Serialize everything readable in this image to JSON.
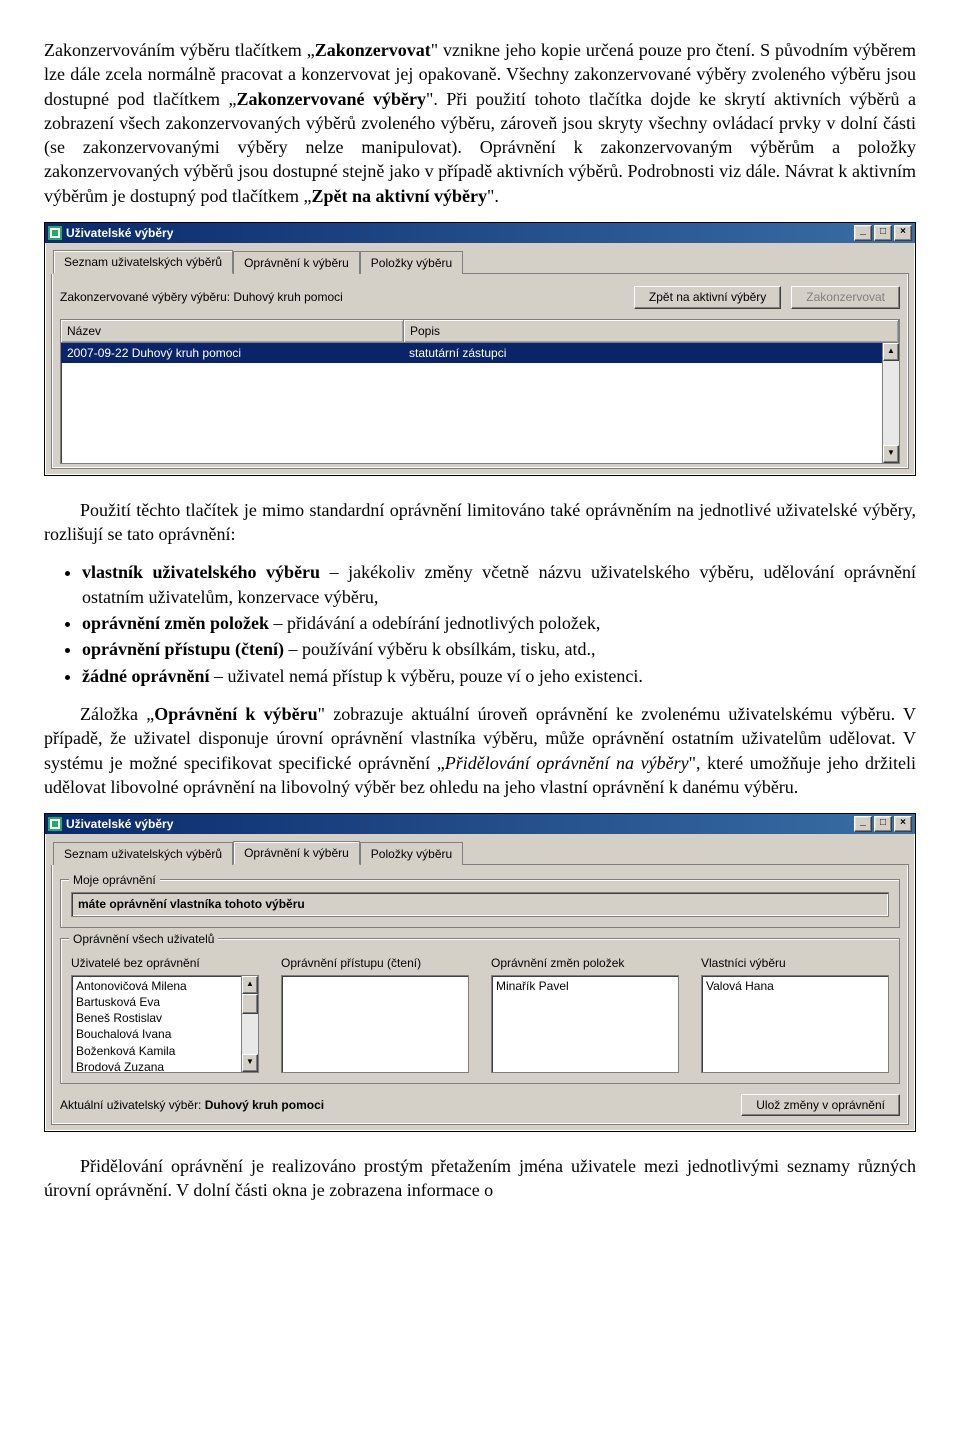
{
  "para1": {
    "seg1": "Zakonzervováním výběru tlačítkem „",
    "btn_zakonzervovat": "Zakonzervovat",
    "seg2": "\" vznikne jeho kopie určená pouze pro čtení. S původním výběrem lze dále zcela normálně pracovat a konzervovat jej opakovaně. Všechny zakonzervované výběry zvoleného výběru jsou dostupné pod tlačítkem „",
    "btn_zakonzervovane": "Zakonzervované výběry",
    "seg3": "\". Při použití tohoto tlačítka dojde ke skrytí aktivních výběrů a zobrazení všech zakonzervovaných výběrů zvoleného výběru, zároveň jsou skryty všechny ovládací prvky v dolní části (se zakonzervovanými výběry nelze manipulovat). Oprávnění k zakonzervovaným výběrům a položky zakonzervovaných výběrů jsou dostupné stejně jako v případě aktivních výběrů. Podrobnosti viz dále. Návrat k aktivním výběrům je dostupný pod tlačítkem „",
    "btn_zpet": "Zpět na aktivní výběry",
    "seg4": "\"."
  },
  "win1": {
    "title": "Uživatelské výběry",
    "tabs": [
      "Seznam uživatelských výběrů",
      "Oprávnění k výběru",
      "Položky výběru"
    ],
    "toolbar_label": "Zakonzervované výběry výběru: Duhový kruh pomoci",
    "btn_back": "Zpět na aktivní výběry",
    "btn_preserve": "Zakonzervovat",
    "col_nazev": "Název",
    "col_popis": "Popis",
    "row": {
      "nazev": "2007-09-22 Duhový kruh pomoci",
      "popis": "statutární zástupci"
    }
  },
  "para2": {
    "text": "Použití těchto tlačítek je mimo standardní oprávnění limitováno také oprávněním na jednotlivé uživatelské výběry, rozlišují se tato oprávnění:"
  },
  "bullets": [
    {
      "bold": "vlastník uživatelského výběru",
      "rest": " – jakékoliv změny včetně názvu uživatelského výběru, udělování oprávnění ostatním uživatelům, konzervace výběru,"
    },
    {
      "bold": "oprávnění změn položek",
      "rest": " – přidávání a odebírání jednotlivých položek,"
    },
    {
      "bold": "oprávnění přístupu (čtení)",
      "rest": " – používání výběru k obsílkám, tisku, atd.,"
    },
    {
      "bold": "žádné oprávnění",
      "rest": " – uživatel nemá přístup k výběru, pouze ví o jeho existenci."
    }
  ],
  "para3": {
    "seg1": "Záložka „",
    "tabname": "Oprávnění k výběru",
    "seg2": "\" zobrazuje aktuální úroveň oprávnění ke zvolenému uživatelskému výběru. V případě, že uživatel disponuje úrovní oprávnění vlastníka výběru, může oprávnění ostatním uživatelům udělovat. V systému je možné specifikovat specifické oprávnění „",
    "special": "Přidělování oprávnění na výběry",
    "seg3": "\", které umožňuje jeho držiteli udělovat libovolné oprávnění na libovolný výběr bez ohledu na jeho vlastní oprávnění k danému výběru."
  },
  "win2": {
    "title": "Uživatelské výběry",
    "tabs": [
      "Seznam uživatelských výběrů",
      "Oprávnění k výběru",
      "Položky výběru"
    ],
    "group_moje": "Moje oprávnění",
    "moje_text": "máte oprávnění vlastníka tohoto výběru",
    "group_all": "Oprávnění všech uživatelů",
    "cols": {
      "no_perm": "Uživatelé bez oprávnění",
      "read": "Oprávnění přístupu (čtení)",
      "change": "Oprávnění změn položek",
      "owners": "Vlastníci výběru"
    },
    "no_perm_users": [
      "Antonovičová Milena",
      "Bartusková Eva",
      "Beneš Rostislav",
      "Bouchalová Ivana",
      "Boženková Kamila",
      "Brodová Zuzana"
    ],
    "read_users": [],
    "change_users": [
      "Minařík Pavel"
    ],
    "owner_users": [
      "Valová Hana"
    ],
    "bottom_label": "Aktuální uživatelský výběr:",
    "bottom_value": "Duhový kruh pomoci",
    "btn_save": "Ulož změny v oprávnění"
  },
  "para4": "Přidělování oprávnění je realizováno prostým přetažením jména uživatele mezi jednotlivými seznamy různých úrovní oprávnění. V dolní části okna je zobrazena informace o"
}
